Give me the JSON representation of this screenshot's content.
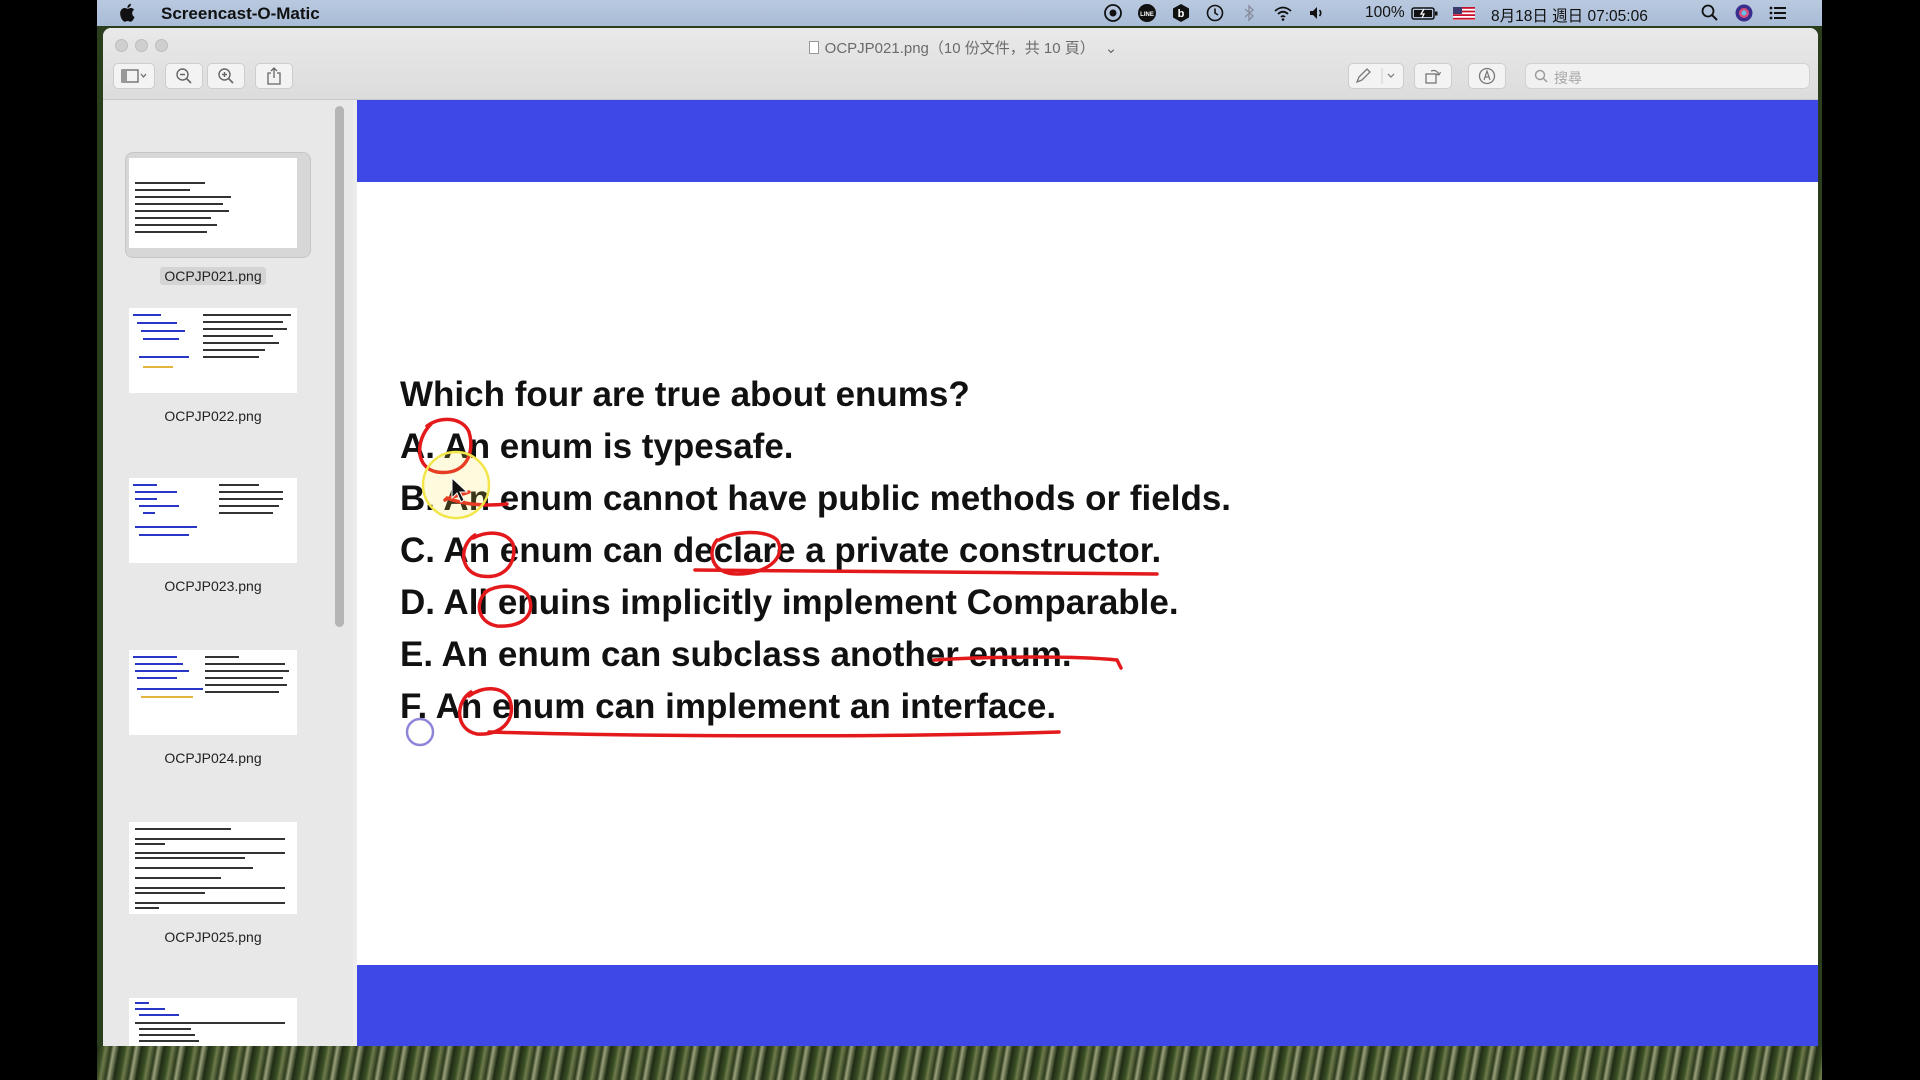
{
  "menubar": {
    "app_name": "Screencast-O-Matic",
    "battery": "100%",
    "datetime": "8月18日 週日 07:05:06"
  },
  "window": {
    "title": "OCPJP021.png（10 份文件，共 10 頁）"
  },
  "search": {
    "placeholder": "搜尋"
  },
  "sidebar": {
    "items": [
      {
        "label": "OCPJP021.png"
      },
      {
        "label": "OCPJP022.png"
      },
      {
        "label": "OCPJP023.png"
      },
      {
        "label": "OCPJP024.png"
      },
      {
        "label": "OCPJP025.png"
      }
    ]
  },
  "slide": {
    "question": "Which four are true about enums?",
    "options": [
      "A. An enum is typesafe.",
      "B. An enum cannot have public methods or fields.",
      "C. An enum can declare a private constructor.",
      "D. All enuins implicitly implement Comparable.",
      "E. An enum can subclass another enum.",
      "F. An enum can implement an interface."
    ]
  },
  "colors": {
    "slide_band": "#3e48e6",
    "annotation_red": "#e3191c",
    "cursor_highlight": "#f2e64a"
  }
}
